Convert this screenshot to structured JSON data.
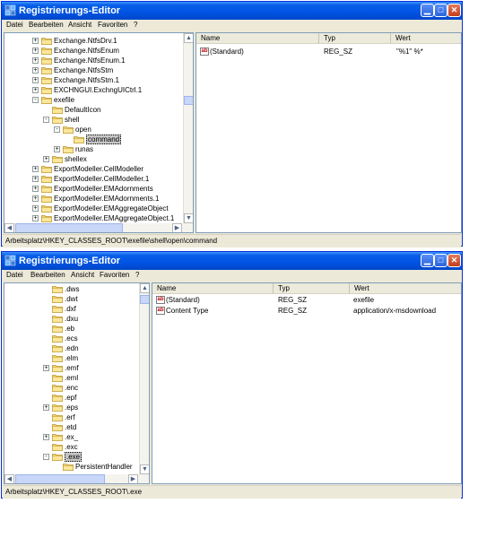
{
  "windows": [
    {
      "title": "Registrierungs-Editor",
      "menu": [
        "Datei",
        "Bearbeiten",
        "Ansicht",
        "Favoriten",
        "?"
      ],
      "tree": [
        {
          "label": "Exchange.NtfsDrv.1",
          "expander": "+"
        },
        {
          "label": "Exchange.NtfsEnum",
          "expander": "+"
        },
        {
          "label": "Exchange.NtfsEnum.1",
          "expander": "+"
        },
        {
          "label": "Exchange.NtfsStm",
          "expander": "+"
        },
        {
          "label": "Exchange.NtfsStm.1",
          "expander": "+"
        },
        {
          "label": "EXCHNGUI.ExchngUICtrl.1",
          "expander": "+"
        },
        {
          "label": "exefile",
          "expander": "-"
        },
        {
          "label": "DefaultIcon",
          "expander": ""
        },
        {
          "label": "shell",
          "expander": "-"
        },
        {
          "label": "open",
          "expander": "-"
        },
        {
          "label": "command",
          "expander": "",
          "selected": true
        },
        {
          "label": "runas",
          "expander": "+"
        },
        {
          "label": "shellex",
          "expander": "+"
        },
        {
          "label": "ExportModeller.CellModeller",
          "expander": "+"
        },
        {
          "label": "ExportModeller.CellModeller.1",
          "expander": "+"
        },
        {
          "label": "ExportModeller.EMAdornments",
          "expander": "+"
        },
        {
          "label": "ExportModeller.EMAdornments.1",
          "expander": "+"
        },
        {
          "label": "ExportModeller.EMAggregateObject",
          "expander": "+"
        },
        {
          "label": "ExportModeller.EMAggregateObject.1",
          "expander": "+"
        }
      ],
      "columns": [
        "Name",
        "Typ",
        "Wert"
      ],
      "values": [
        {
          "name": "(Standard)",
          "type": "REG_SZ",
          "data": "\"%1\" %*"
        }
      ],
      "status": "Arbeitsplatz\\HKEY_CLASSES_ROOT\\exefile\\shell\\open\\command"
    },
    {
      "title": "Registrierungs-Editor",
      "menu": [
        "Datei",
        "Bearbeiten",
        "Ansicht",
        "Favoriten",
        "?"
      ],
      "tree": [
        {
          "label": ".dws",
          "expander": ""
        },
        {
          "label": ".dwt",
          "expander": ""
        },
        {
          "label": ".dxf",
          "expander": ""
        },
        {
          "label": ".dxu",
          "expander": ""
        },
        {
          "label": ".eb",
          "expander": ""
        },
        {
          "label": ".ecs",
          "expander": ""
        },
        {
          "label": ".edn",
          "expander": ""
        },
        {
          "label": ".elm",
          "expander": ""
        },
        {
          "label": ".emf",
          "expander": "+"
        },
        {
          "label": ".eml",
          "expander": ""
        },
        {
          "label": ".enc",
          "expander": ""
        },
        {
          "label": ".epf",
          "expander": ""
        },
        {
          "label": ".eps",
          "expander": "+"
        },
        {
          "label": ".erf",
          "expander": ""
        },
        {
          "label": ".etd",
          "expander": ""
        },
        {
          "label": ".ex_",
          "expander": "+"
        },
        {
          "label": ".exc",
          "expander": ""
        },
        {
          "label": ".exe",
          "expander": "-",
          "selected": true
        },
        {
          "label": "PersistentHandler",
          "expander": ""
        }
      ],
      "columns": [
        "Name",
        "Typ",
        "Wert"
      ],
      "values": [
        {
          "name": "(Standard)",
          "type": "REG_SZ",
          "data": "exefile"
        },
        {
          "name": "Content Type",
          "type": "REG_SZ",
          "data": "application/x-msdownload"
        }
      ],
      "status": "Arbeitsplatz\\HKEY_CLASSES_ROOT\\.exe"
    }
  ],
  "icons": {
    "app": "registry-editor-icon",
    "folder": "folder-icon",
    "value": "string-value-icon",
    "minimize": "minimize-icon",
    "maximize": "maximize-icon",
    "close": "close-icon"
  }
}
